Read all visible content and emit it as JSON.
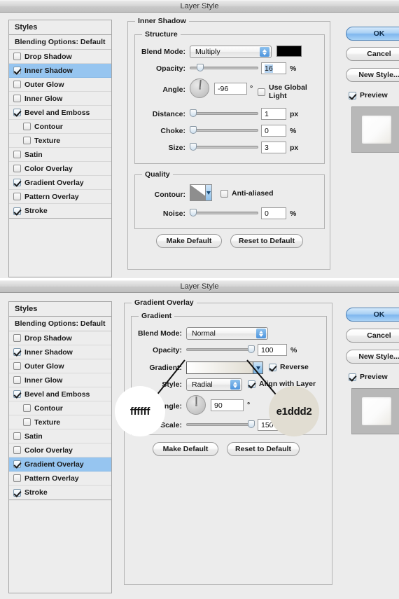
{
  "dialogs": [
    {
      "title": "Layer Style",
      "section_title": "Inner Shadow",
      "styles_panel": {
        "header": "Styles",
        "blending_options": "Blending Options: Default",
        "items": [
          {
            "label": "Drop Shadow",
            "checked": false,
            "indent": false,
            "selected": false
          },
          {
            "label": "Inner Shadow",
            "checked": true,
            "indent": false,
            "selected": true
          },
          {
            "label": "Outer Glow",
            "checked": false,
            "indent": false,
            "selected": false
          },
          {
            "label": "Inner Glow",
            "checked": false,
            "indent": false,
            "selected": false
          },
          {
            "label": "Bevel and Emboss",
            "checked": true,
            "indent": false,
            "selected": false
          },
          {
            "label": "Contour",
            "checked": false,
            "indent": true,
            "selected": false
          },
          {
            "label": "Texture",
            "checked": false,
            "indent": true,
            "selected": false
          },
          {
            "label": "Satin",
            "checked": false,
            "indent": false,
            "selected": false
          },
          {
            "label": "Color Overlay",
            "checked": false,
            "indent": false,
            "selected": false
          },
          {
            "label": "Gradient Overlay",
            "checked": true,
            "indent": false,
            "selected": false
          },
          {
            "label": "Pattern Overlay",
            "checked": false,
            "indent": false,
            "selected": false
          },
          {
            "label": "Stroke",
            "checked": true,
            "indent": false,
            "selected": false
          }
        ]
      },
      "structure": {
        "group_label": "Structure",
        "blend_mode_label": "Blend Mode:",
        "blend_mode_value": "Multiply",
        "color_swatch": "#000000",
        "opacity_label": "Opacity:",
        "opacity_value": "16",
        "opacity_unit": "%",
        "angle_label": "Angle:",
        "angle_value": "-96",
        "angle_unit": "°",
        "use_global_light": "Use Global Light",
        "use_global_light_checked": false,
        "distance_label": "Distance:",
        "distance_value": "1",
        "distance_unit": "px",
        "choke_label": "Choke:",
        "choke_value": "0",
        "choke_unit": "%",
        "size_label": "Size:",
        "size_value": "3",
        "size_unit": "px"
      },
      "quality": {
        "group_label": "Quality",
        "contour_label": "Contour:",
        "anti_aliased": "Anti-aliased",
        "anti_aliased_checked": false,
        "noise_label": "Noise:",
        "noise_value": "0",
        "noise_unit": "%"
      },
      "footer_buttons": [
        {
          "label": "Make Default"
        },
        {
          "label": "Reset to Default"
        }
      ],
      "right_buttons": [
        {
          "label": "OK",
          "primary": true
        },
        {
          "label": "Cancel",
          "primary": false
        },
        {
          "label": "New Style...",
          "primary": false
        }
      ],
      "preview_checkbox": {
        "label": "Preview",
        "checked": true
      }
    },
    {
      "title": "Layer Style",
      "section_title": "Gradient Overlay",
      "styles_panel": {
        "header": "Styles",
        "blending_options": "Blending Options: Default",
        "items": [
          {
            "label": "Drop Shadow",
            "checked": false,
            "indent": false,
            "selected": false
          },
          {
            "label": "Inner Shadow",
            "checked": true,
            "indent": false,
            "selected": false
          },
          {
            "label": "Outer Glow",
            "checked": false,
            "indent": false,
            "selected": false
          },
          {
            "label": "Inner Glow",
            "checked": false,
            "indent": false,
            "selected": false
          },
          {
            "label": "Bevel and Emboss",
            "checked": true,
            "indent": false,
            "selected": false
          },
          {
            "label": "Contour",
            "checked": false,
            "indent": true,
            "selected": false
          },
          {
            "label": "Texture",
            "checked": false,
            "indent": true,
            "selected": false
          },
          {
            "label": "Satin",
            "checked": false,
            "indent": false,
            "selected": false
          },
          {
            "label": "Color Overlay",
            "checked": false,
            "indent": false,
            "selected": false
          },
          {
            "label": "Gradient Overlay",
            "checked": true,
            "indent": false,
            "selected": true
          },
          {
            "label": "Pattern Overlay",
            "checked": false,
            "indent": false,
            "selected": false
          },
          {
            "label": "Stroke",
            "checked": true,
            "indent": false,
            "selected": false
          }
        ]
      },
      "gradient": {
        "group_label": "Gradient",
        "blend_mode_label": "Blend Mode:",
        "blend_mode_value": "Normal",
        "opacity_label": "Opacity:",
        "opacity_value": "100",
        "opacity_unit": "%",
        "gradient_label": "Gradient:",
        "reverse": "Reverse",
        "reverse_checked": true,
        "style_label": "Style:",
        "style_value": "Radial",
        "align_with_layer": "Align with Layer",
        "align_with_layer_checked": true,
        "angle_label": "Angle:",
        "angle_value": "90",
        "angle_unit": "°",
        "scale_label": "Scale:",
        "scale_value": "150",
        "scale_unit": "%"
      },
      "footer_buttons": [
        {
          "label": "Make Default"
        },
        {
          "label": "Reset to Default"
        }
      ],
      "right_buttons": [
        {
          "label": "OK",
          "primary": true
        },
        {
          "label": "Cancel",
          "primary": false
        },
        {
          "label": "New Style...",
          "primary": false
        }
      ],
      "preview_checkbox": {
        "label": "Preview",
        "checked": true
      }
    }
  ],
  "annotations": [
    {
      "text": "ffffff",
      "color": "#ffffff"
    },
    {
      "text": "e1ddd2",
      "color": "#e1ddd2"
    }
  ]
}
